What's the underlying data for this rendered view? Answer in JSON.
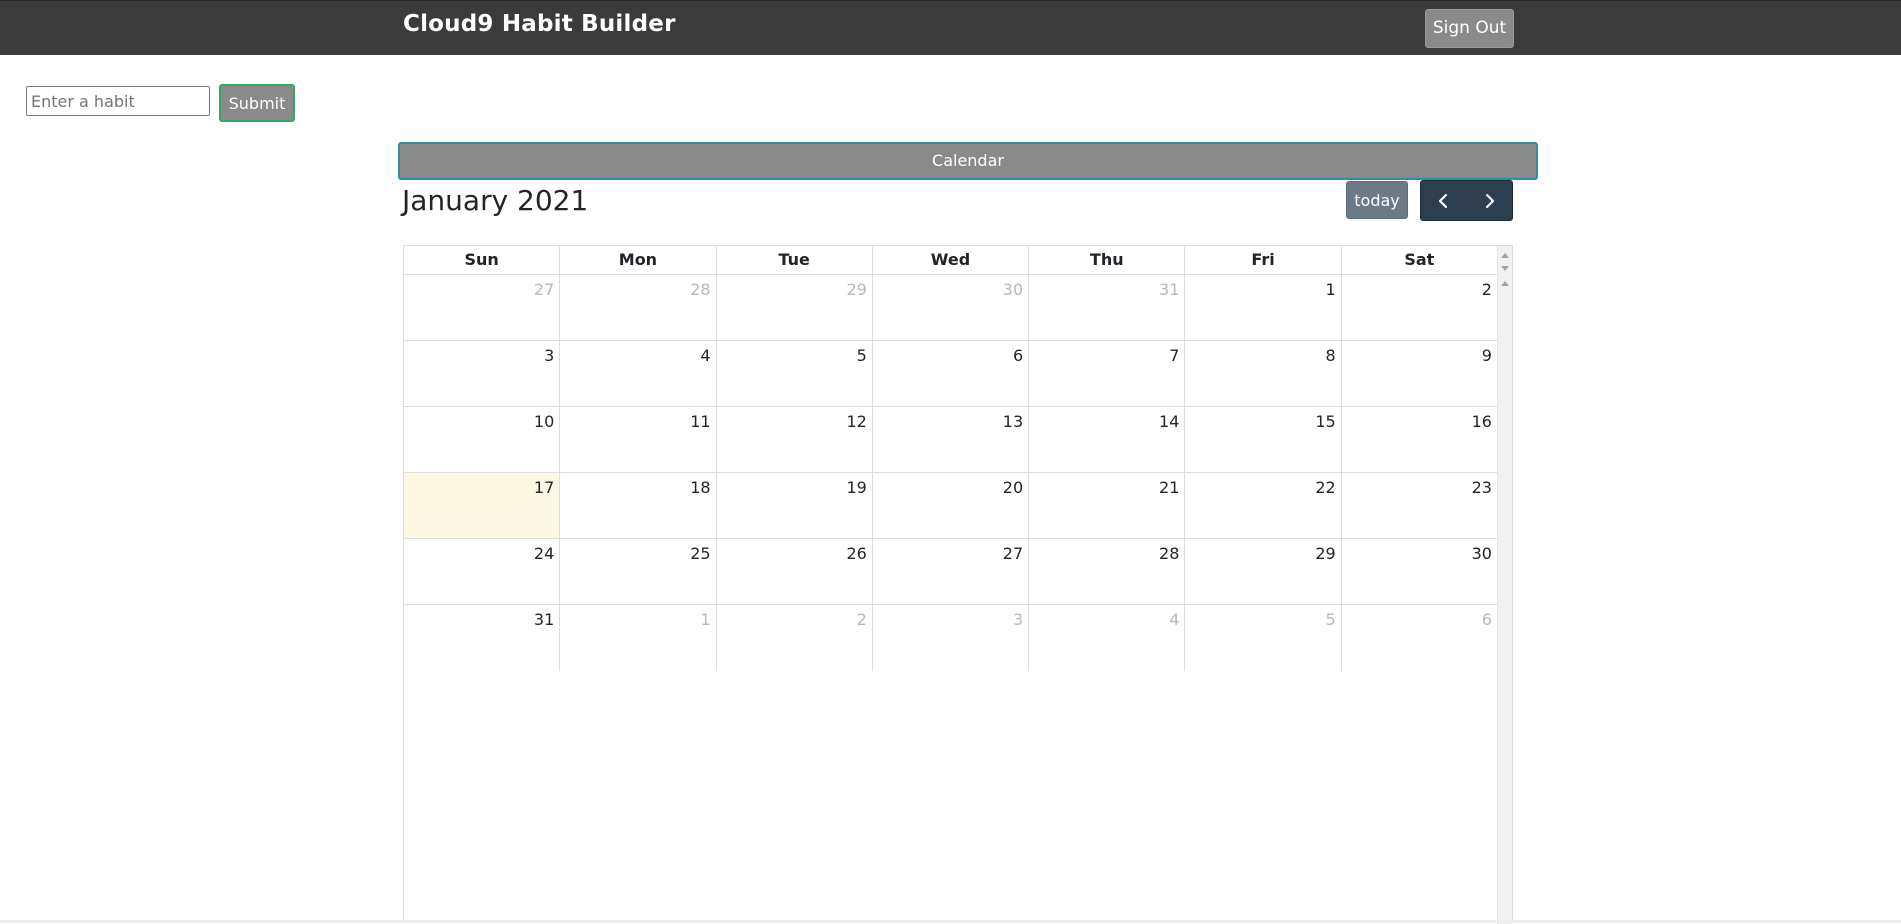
{
  "navbar": {
    "brand": "Cloud9 Habit Builder",
    "signout_label": "Sign Out"
  },
  "habit_form": {
    "placeholder": "Enter a habit",
    "submit_label": "Submit"
  },
  "calendar": {
    "bar_label": "Calendar",
    "month_title": "January 2021",
    "today_label": "today",
    "days_of_week": [
      "Sun",
      "Mon",
      "Tue",
      "Wed",
      "Thu",
      "Fri",
      "Sat"
    ],
    "weeks": [
      [
        {
          "d": "27",
          "other": true
        },
        {
          "d": "28",
          "other": true
        },
        {
          "d": "29",
          "other": true
        },
        {
          "d": "30",
          "other": true
        },
        {
          "d": "31",
          "other": true
        },
        {
          "d": "1"
        },
        {
          "d": "2"
        }
      ],
      [
        {
          "d": "3"
        },
        {
          "d": "4"
        },
        {
          "d": "5"
        },
        {
          "d": "6"
        },
        {
          "d": "7"
        },
        {
          "d": "8"
        },
        {
          "d": "9"
        }
      ],
      [
        {
          "d": "10"
        },
        {
          "d": "11"
        },
        {
          "d": "12"
        },
        {
          "d": "13"
        },
        {
          "d": "14"
        },
        {
          "d": "15"
        },
        {
          "d": "16"
        }
      ],
      [
        {
          "d": "17",
          "today": true
        },
        {
          "d": "18"
        },
        {
          "d": "19"
        },
        {
          "d": "20"
        },
        {
          "d": "21"
        },
        {
          "d": "22"
        },
        {
          "d": "23"
        }
      ],
      [
        {
          "d": "24"
        },
        {
          "d": "25"
        },
        {
          "d": "26"
        },
        {
          "d": "27"
        },
        {
          "d": "28"
        },
        {
          "d": "29"
        },
        {
          "d": "30"
        }
      ],
      [
        {
          "d": "31"
        },
        {
          "d": "1",
          "other": true
        },
        {
          "d": "2",
          "other": true
        },
        {
          "d": "3",
          "other": true
        },
        {
          "d": "4",
          "other": true
        },
        {
          "d": "5",
          "other": true
        },
        {
          "d": "6",
          "other": true
        }
      ]
    ]
  },
  "icons": {
    "prev": "chevron-left-icon",
    "next": "chevron-right-icon"
  },
  "colors": {
    "navbar_bg": "#3b3b3b",
    "button_gray": "#8a8a8a",
    "nav_dark": "#2c3e50",
    "today_highlight": "#fcf8e3",
    "submit_border": "#3aa35c",
    "calendar_bar_border": "#2d8fa6"
  }
}
